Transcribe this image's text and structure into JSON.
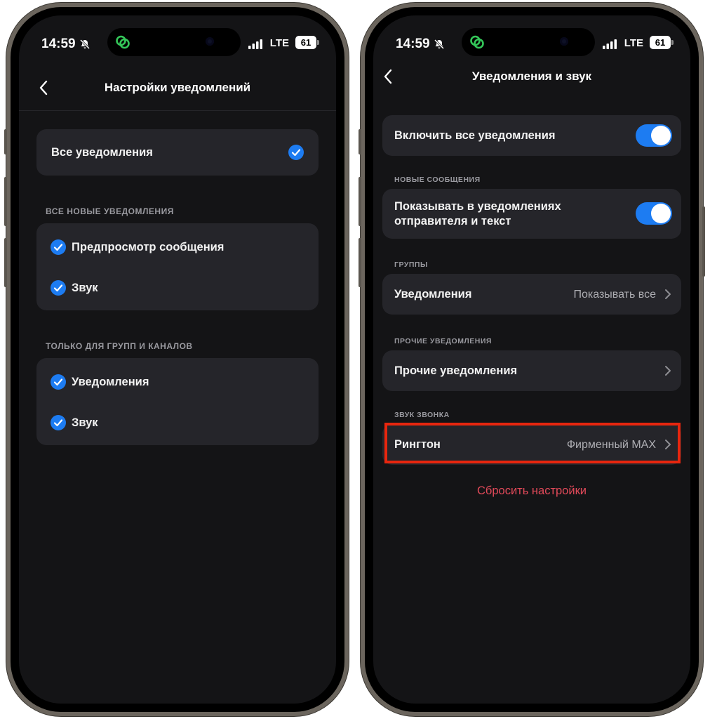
{
  "status_bar": {
    "time": "14:59",
    "network": "LTE",
    "battery": "61"
  },
  "left_screen": {
    "title": "Настройки уведомлений",
    "all_notifications": {
      "label": "Все уведомления",
      "checked": true
    },
    "section_new": {
      "header": "ВСЕ НОВЫЕ УВЕДОМЛЕНИЯ",
      "items": [
        {
          "label": "Предпросмотр сообщения",
          "checked": true
        },
        {
          "label": "Звук",
          "checked": true
        }
      ]
    },
    "section_groups": {
      "header": "ТОЛЬКО ДЛЯ ГРУПП И КАНАЛОВ",
      "items": [
        {
          "label": "Уведомления",
          "checked": true
        },
        {
          "label": "Звук",
          "checked": true
        }
      ]
    }
  },
  "right_screen": {
    "title": "Уведомления и звук",
    "enable_all": {
      "label": "Включить все уведомления",
      "on": true
    },
    "section_new_messages": {
      "header": "НОВЫЕ СООБЩЕНИЯ",
      "row": {
        "label_line1": "Показывать в уведомлениях",
        "label_line2": "отправителя и текст",
        "on": true
      }
    },
    "section_groups": {
      "header": "ГРУППЫ",
      "row": {
        "label": "Уведомления",
        "value": "Показывать все"
      }
    },
    "section_other": {
      "header": "ПРОЧИЕ УВЕДОМЛЕНИЯ",
      "row": {
        "label": "Прочие уведомления"
      }
    },
    "section_ringtone": {
      "header": "ЗВУК ЗВОНКА",
      "row": {
        "label": "Рингтон",
        "value": "Фирменный MAX"
      }
    },
    "reset_label": "Сбросить настройки"
  },
  "colors": {
    "accent": "#1d7cf2",
    "highlight": "#e8260e",
    "reset": "#e34a5a",
    "card": "#25252a",
    "background": "#141416"
  },
  "icons": [
    "back-chevron-icon",
    "checkmark-circle-icon",
    "chevron-right-icon",
    "silent-bell-icon",
    "signal-icon",
    "app-link-icon"
  ]
}
